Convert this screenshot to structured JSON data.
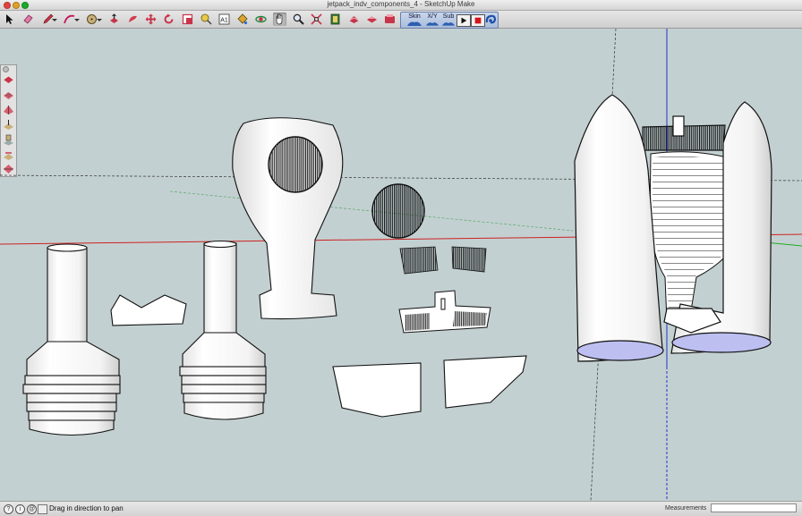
{
  "window": {
    "title": "jetpack_indv_components_4 - SketchUp Make",
    "close_color": "#e0443e",
    "minimize_color": "#dea123",
    "zoom_color": "#1aab29"
  },
  "toolbar": {
    "tools": [
      {
        "name": "select-tool-icon"
      },
      {
        "name": "eraser-tool-icon"
      },
      {
        "name": "pencil-tool-icon"
      },
      {
        "name": "arc-tool-icon"
      },
      {
        "name": "circle-tool-icon"
      },
      {
        "name": "push-pull-tool-icon"
      },
      {
        "name": "follow-me-tool-icon"
      },
      {
        "name": "move-tool-icon"
      },
      {
        "name": "rotate-tool-icon"
      },
      {
        "name": "scale-tool-icon"
      },
      {
        "name": "tape-measure-tool-icon"
      },
      {
        "name": "text-tool-icon"
      },
      {
        "name": "paint-bucket-tool-icon"
      },
      {
        "name": "orbit-tool-icon"
      },
      {
        "name": "pan-tool-icon"
      },
      {
        "name": "zoom-tool-icon"
      },
      {
        "name": "zoom-extents-tool-icon"
      },
      {
        "name": "warehouse-icon"
      },
      {
        "name": "share-model-icon"
      },
      {
        "name": "components-icon"
      },
      {
        "name": "extension-warehouse-icon"
      },
      {
        "name": "layout-icon"
      }
    ],
    "ruby_group": {
      "skin_label": "Skin",
      "xy_label": "X/Y",
      "sub_label": "Sub"
    }
  },
  "palette": {
    "tools": [
      {
        "name": "palette-paint-icon"
      },
      {
        "name": "palette-texture-icon"
      },
      {
        "name": "palette-sandbox-icon"
      },
      {
        "name": "palette-smoove-icon"
      },
      {
        "name": "palette-stamp-icon"
      },
      {
        "name": "palette-drape-icon"
      },
      {
        "name": "palette-flip-icon"
      }
    ]
  },
  "colors": {
    "sky": "#c3d0d1",
    "axis_red": "#cc2222",
    "axis_green": "#22aa22",
    "axis_blue": "#2233cc",
    "model_fill": "#ffffff",
    "model_edge": "#111111"
  },
  "status": {
    "message": "Drag in direction to pan",
    "measurements_label": "Measurements",
    "measurements_value": ""
  }
}
